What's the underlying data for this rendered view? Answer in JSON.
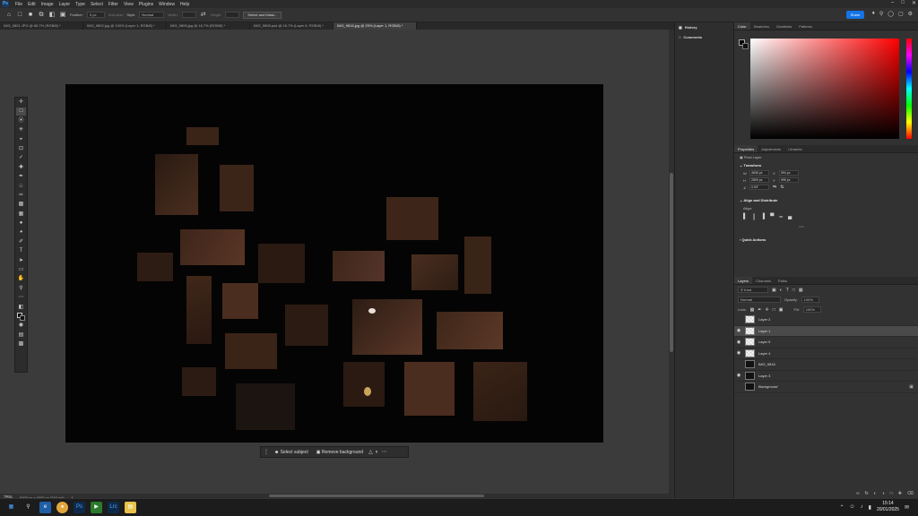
{
  "app": {
    "logo": "Ps"
  },
  "menubar": {
    "items": [
      "File",
      "Edit",
      "Image",
      "Layer",
      "Type",
      "Select",
      "Filter",
      "View",
      "Plugins",
      "Window",
      "Help"
    ]
  },
  "options": {
    "feather_label": "Feather:",
    "feather_value": "0 px",
    "antialias_label": "Anti-alias",
    "style_label": "Style:",
    "style_value": "Normal",
    "width_label": "Width:",
    "height_label": "Height:",
    "select_mask": "Select and Mask...",
    "share": "Share"
  },
  "tabs": [
    "IMG_9801.JPG @ 66.7% (RGB/8) *",
    "IMG_9802.jpg @ 100% (Layer 1, RGB/8) *",
    "IMG_9806.jpg @ 16.7% (RGB/8) *",
    "IMG_9808.psd @ 16.7% (Layer 6, RGB/8) *",
    "IMG_9816.jpg @ 25% (Layer 1, RGB/8) *"
  ],
  "contextbar": {
    "select_subject": "Select subject",
    "remove_background": "Remove background"
  },
  "status": {
    "zoom": "25%",
    "size": "6000 px x 4000 px (240 ppi)"
  },
  "side_strip": {
    "history": "History",
    "comments": "Comments"
  },
  "color_panel": {
    "tabs": [
      "Color",
      "Swatches",
      "Gradients",
      "Patterns"
    ]
  },
  "properties": {
    "tabs": [
      "Properties",
      "Adjustments",
      "Libraries"
    ],
    "layer_type": "Pixel Layer",
    "transform_title": "Transform",
    "W": "4636 px",
    "X": "994 px",
    "H": "2809 px",
    "Y": "995 px",
    "angle": "0.00°",
    "align_title": "Align and Distribute",
    "align_label": "Align:",
    "quick_actions": "Quick Actions"
  },
  "layers_panel": {
    "tabs": [
      "Layers",
      "Channels",
      "Paths"
    ],
    "kind": "Kind",
    "blend": "Normal",
    "opacity_label": "Opacity:",
    "opacity": "100%",
    "lock_label": "Lock:",
    "fill_label": "Fill:",
    "fill": "100%",
    "layers": [
      "Layer 2",
      "Layer 1",
      "Layer 5",
      "Layer 4",
      "IMG_9816",
      "Layer 3",
      "Background"
    ]
  },
  "taskbar": {
    "time": "15:14",
    "date": "20/01/2025"
  }
}
